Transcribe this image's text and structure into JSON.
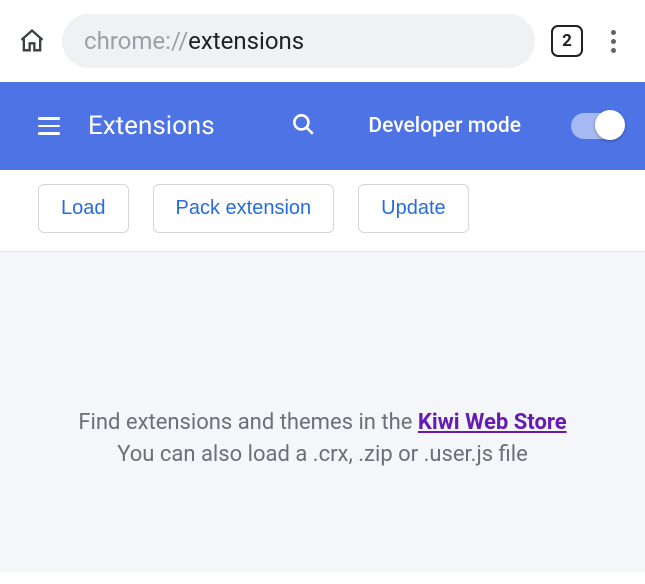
{
  "browser": {
    "omnibox_scheme": "chrome://",
    "omnibox_path": "extensions",
    "tab_count": "2"
  },
  "header": {
    "title": "Extensions",
    "developer_mode_label": "Developer mode",
    "developer_mode_on": true
  },
  "toolbar": {
    "load_label": "Load",
    "pack_label": "Pack extension",
    "update_label": "Update"
  },
  "content": {
    "line1_prefix": "Find extensions and themes in the ",
    "store_link_text": "Kiwi Web Store",
    "line2": "You can also load a .crx, .zip or .user.js file"
  }
}
